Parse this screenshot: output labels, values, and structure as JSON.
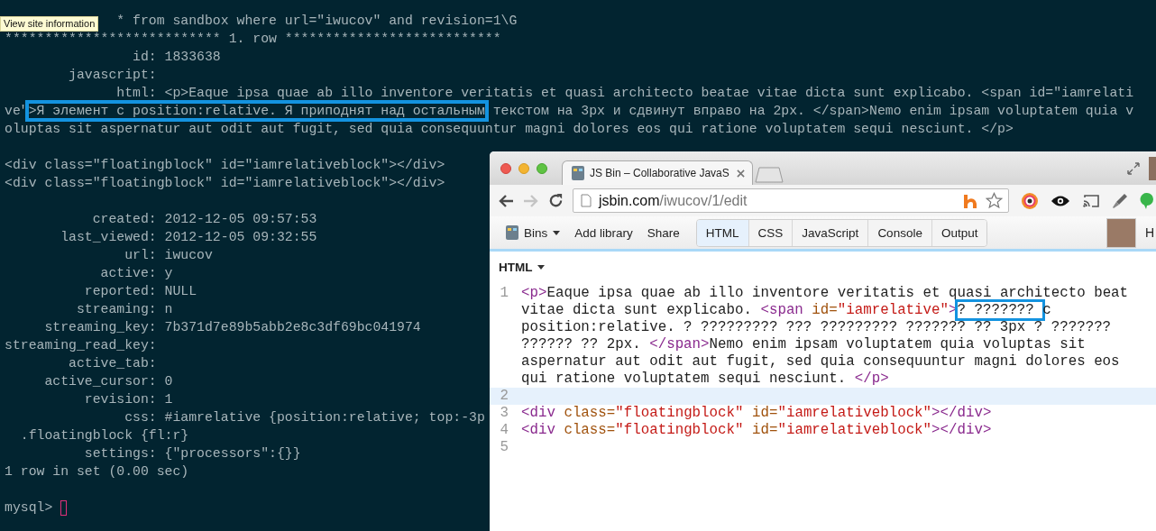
{
  "tooltip": "View site information",
  "terminal": {
    "lines": [
      {
        "kind": "text",
        "text": "* from sandbox where url=\"iwucov\" and revision=1\\G"
      },
      {
        "kind": "text",
        "text": "*************************** 1. row ***************************"
      },
      {
        "kind": "text",
        "text": "                id: 1833638"
      },
      {
        "kind": "text",
        "text": "        javascript:"
      },
      {
        "kind": "text",
        "text": "              html: <p>Eaque ipsa quae ab illo inventore veritatis et quasi architecto beatae vitae dicta sunt explicabo. <span id=\"iamrelati"
      },
      {
        "kind": "marked",
        "before": "ve\"",
        "marked": ">Я элемент с position:relative. Я приподнят над остальным",
        "after": " текстом на 3px и сдвинут вправо на 2px. </span>Nemo enim ipsam voluptatem quia v"
      },
      {
        "kind": "text",
        "text": "oluptas sit aspernatur aut odit aut fugit, sed quia consequuntur magni dolores eos qui ratione voluptatem sequi nesciunt. </p>"
      },
      {
        "kind": "blank"
      },
      {
        "kind": "text",
        "text": "<div class=\"floatingblock\" id=\"iamrelativeblock\"></div>"
      },
      {
        "kind": "text",
        "text": "<div class=\"floatingblock\" id=\"iamrelativeblock\"></div>"
      },
      {
        "kind": "blank"
      },
      {
        "kind": "text",
        "text": "           created: 2012-12-05 09:57:53"
      },
      {
        "kind": "text",
        "text": "       last_viewed: 2012-12-05 09:32:55"
      },
      {
        "kind": "text",
        "text": "               url: iwucov"
      },
      {
        "kind": "text",
        "text": "            active: y"
      },
      {
        "kind": "text",
        "text": "          reported: NULL"
      },
      {
        "kind": "text",
        "text": "         streaming: n"
      },
      {
        "kind": "text",
        "text": "     streaming_key: 7b371d7e89b5abb2e8c3df69bc041974"
      },
      {
        "kind": "text",
        "text": "streaming_read_key:"
      },
      {
        "kind": "text",
        "text": "        active_tab:"
      },
      {
        "kind": "text",
        "text": "     active_cursor: 0"
      },
      {
        "kind": "text",
        "text": "          revision: 1"
      },
      {
        "kind": "text",
        "text": "               css: #iamrelative {position:relative; top:-3p"
      },
      {
        "kind": "text",
        "text": "  .floatingblock {fl:r}"
      },
      {
        "kind": "text",
        "text": "          settings: {\"processors\":{}}"
      },
      {
        "kind": "text",
        "text": "1 row in set (0.00 sec)"
      },
      {
        "kind": "blank"
      },
      {
        "kind": "prompt",
        "text": "mysql>"
      }
    ]
  },
  "browser": {
    "tab_title": "JS Bin – Collaborative JavaS",
    "nav": {
      "back_disabled": false,
      "forward_disabled": true
    },
    "address": {
      "host": "jsbin.com",
      "path": "/iwucov/1/edit"
    },
    "app_bar": {
      "bins": "Bins",
      "links": [
        "Add library",
        "Share"
      ],
      "panels": [
        {
          "label": "HTML",
          "selected": true
        },
        {
          "label": "CSS",
          "selected": false
        },
        {
          "label": "JavaScript",
          "selected": false
        },
        {
          "label": "Console",
          "selected": false
        },
        {
          "label": "Output",
          "selected": false
        }
      ],
      "user_initial": "H"
    },
    "editor": {
      "label": "HTML",
      "lines": [
        {
          "number": "1",
          "current": false,
          "rows": [
            [
              {
                "kind": "tag",
                "text": "<p>"
              },
              {
                "kind": "text",
                "text": "Eaque ipsa quae ab illo inventore veritatis et quasi architecto beat"
              }
            ],
            [
              {
                "kind": "text",
                "text": "vitae dicta sunt explicabo. "
              },
              {
                "kind": "tag",
                "text": "<span "
              },
              {
                "kind": "attr",
                "text": "id="
              },
              {
                "kind": "string",
                "text": "\"iamrelative\""
              },
              {
                "kind": "tag",
                "text": ">"
              },
              {
                "kind": "marked",
                "text": "? ??????? "
              },
              {
                "kind": "text",
                "text": "c"
              }
            ],
            [
              {
                "kind": "text",
                "text": "position:relative. ? ????????? ??? ????????? ??????? ?? 3px ? ???????"
              }
            ],
            [
              {
                "kind": "text",
                "text": "?????? ?? 2px. "
              },
              {
                "kind": "tag",
                "text": "</span>"
              },
              {
                "kind": "text",
                "text": "Nemo enim ipsam voluptatem quia voluptas sit"
              }
            ],
            [
              {
                "kind": "text",
                "text": "aspernatur aut odit aut fugit, sed quia consequuntur magni dolores eos"
              }
            ],
            [
              {
                "kind": "text",
                "text": "qui ratione voluptatem sequi nesciunt. "
              },
              {
                "kind": "tag",
                "text": "</p>"
              }
            ]
          ]
        },
        {
          "number": "2",
          "current": true
        },
        {
          "number": "3",
          "current": false,
          "rows": [
            [
              {
                "kind": "tag",
                "text": "<div "
              },
              {
                "kind": "attr",
                "text": "class="
              },
              {
                "kind": "string",
                "text": "\"floatingblock\""
              },
              {
                "kind": "text",
                "text": " "
              },
              {
                "kind": "attr",
                "text": "id="
              },
              {
                "kind": "string",
                "text": "\"iamrelativeblock\""
              },
              {
                "kind": "tag",
                "text": "></div>"
              }
            ]
          ]
        },
        {
          "number": "4",
          "current": false,
          "rows": [
            [
              {
                "kind": "tag",
                "text": "<div "
              },
              {
                "kind": "attr",
                "text": "class="
              },
              {
                "kind": "string",
                "text": "\"floatingblock\""
              },
              {
                "kind": "text",
                "text": " "
              },
              {
                "kind": "attr",
                "text": "id="
              },
              {
                "kind": "string",
                "text": "\"iamrelativeblock\""
              },
              {
                "kind": "tag",
                "text": "></div>"
              }
            ]
          ]
        },
        {
          "number": "5",
          "current": false
        }
      ]
    }
  }
}
